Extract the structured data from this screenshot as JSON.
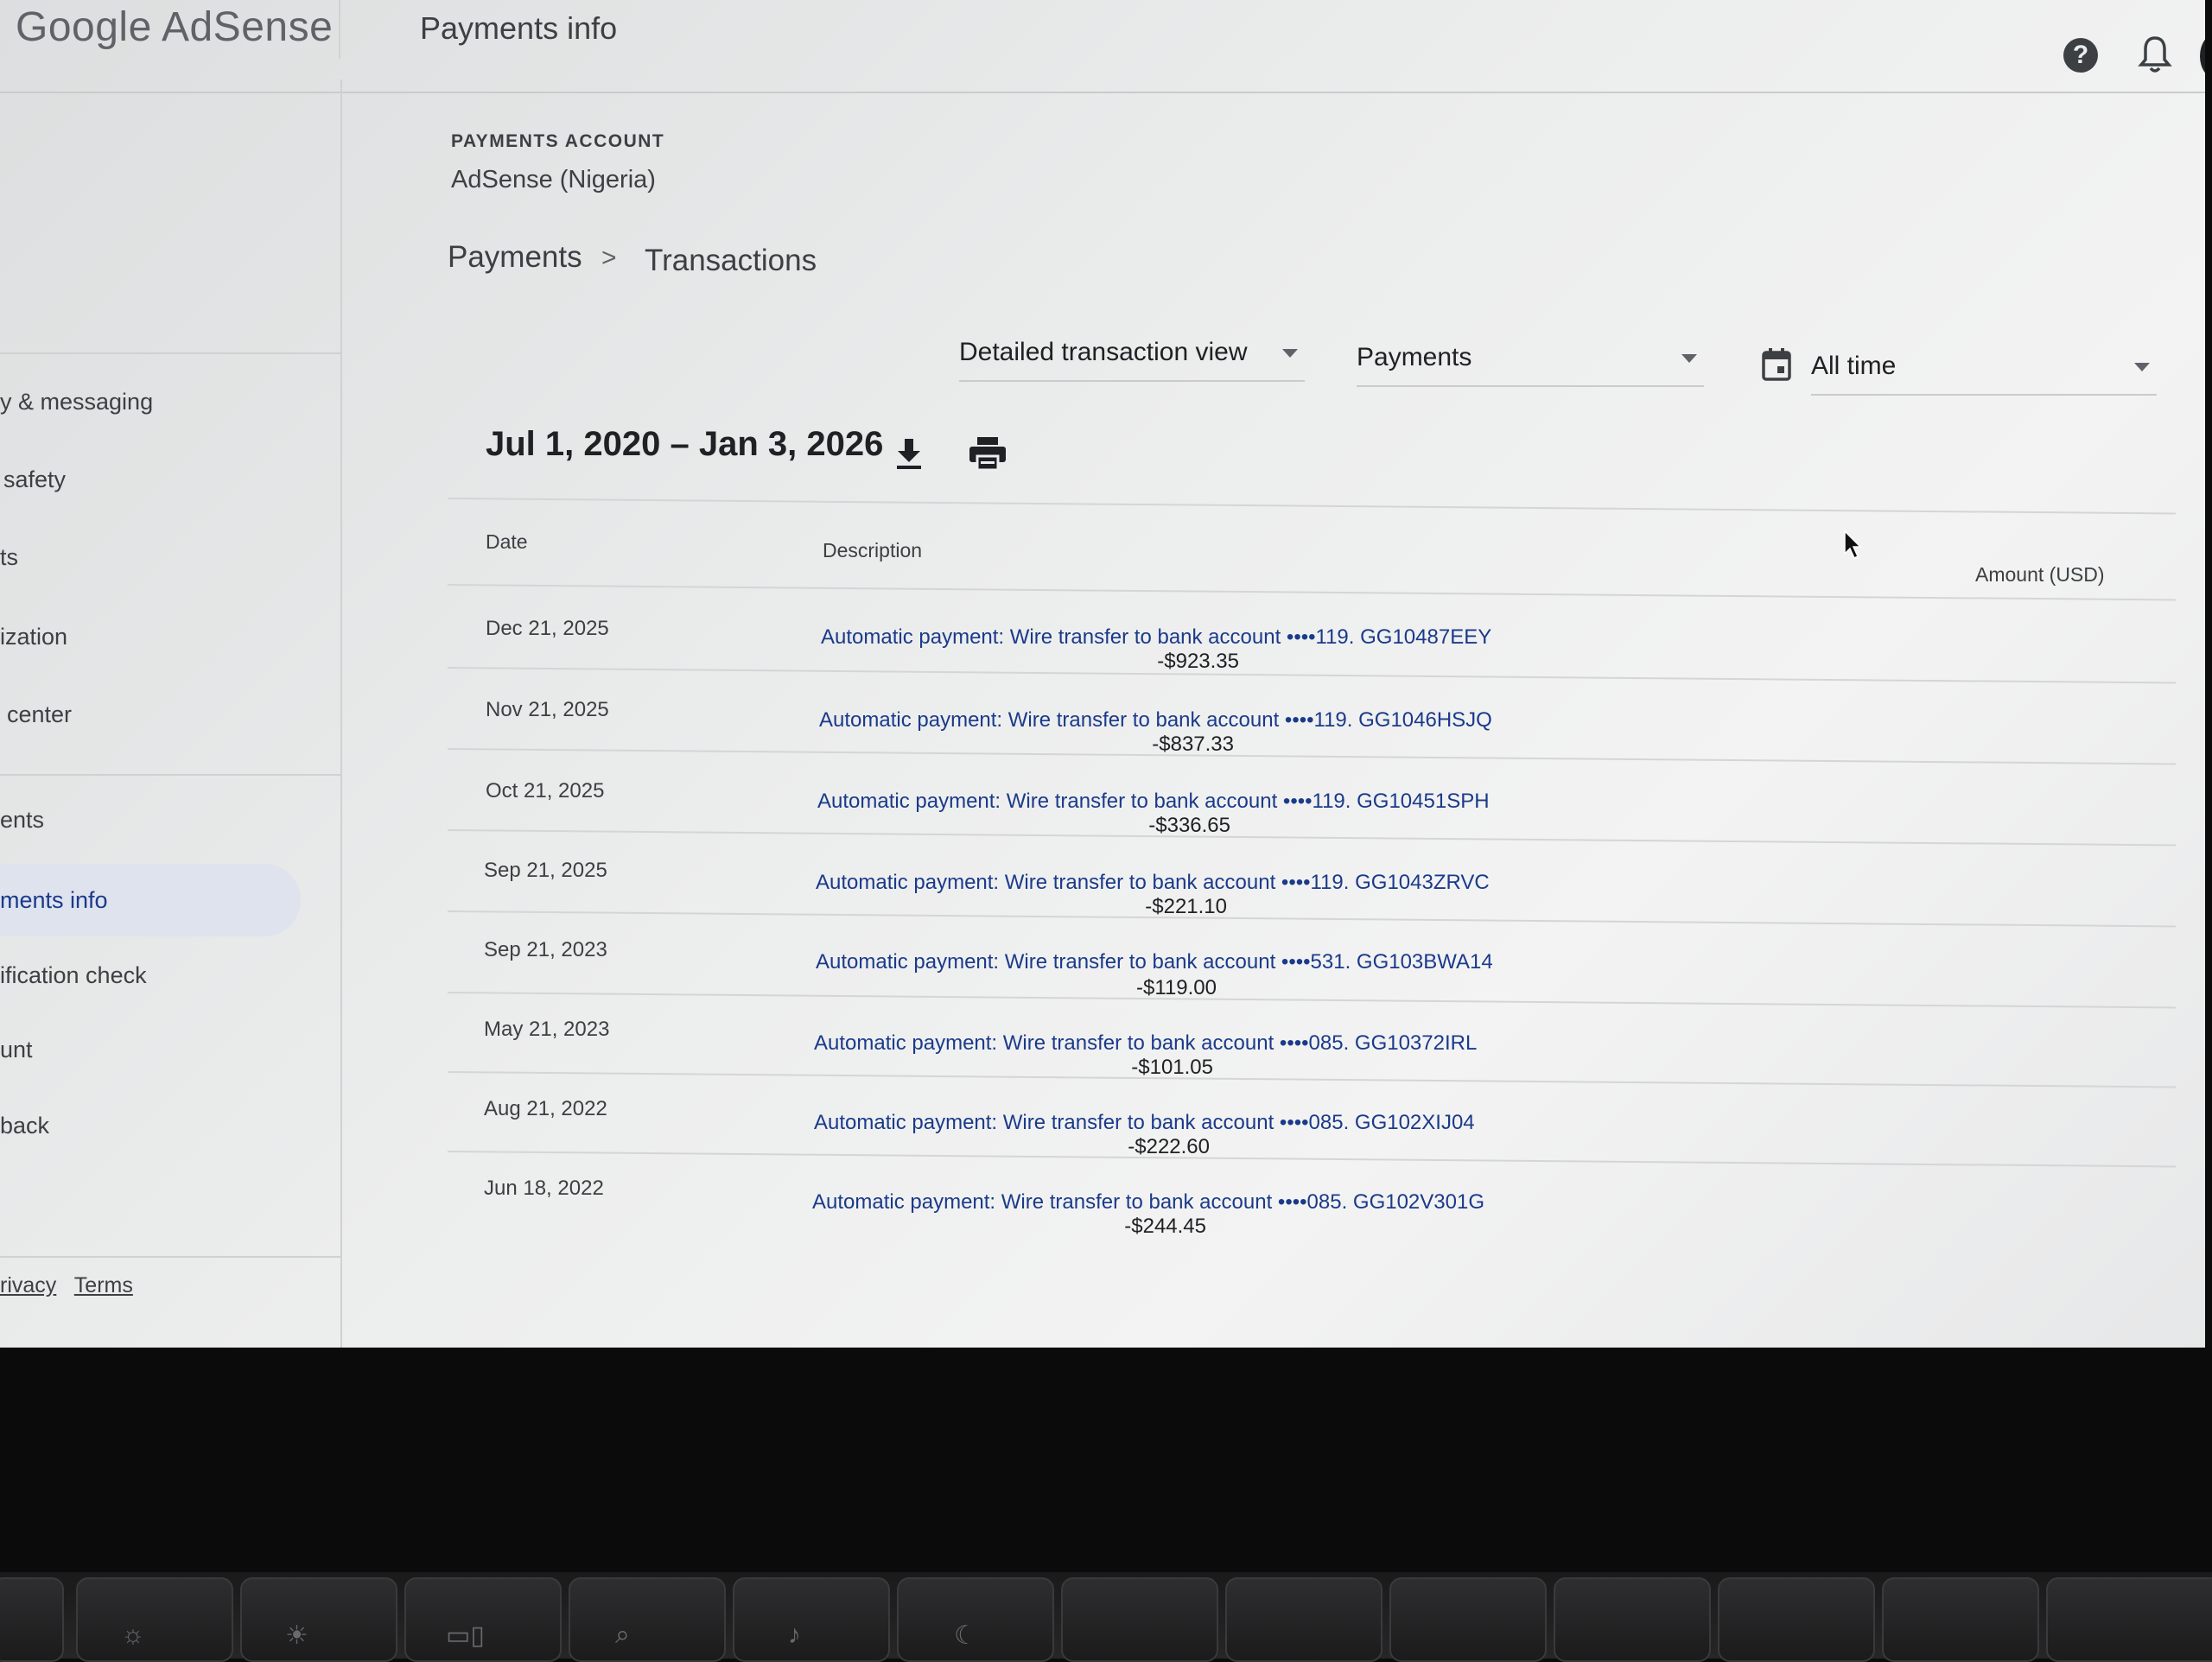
{
  "header": {
    "logo": "Google AdSense",
    "title": "Payments info",
    "help_icon": "?"
  },
  "sidebar": {
    "items": [
      {
        "label": "y & messaging"
      },
      {
        "label": "safety"
      },
      {
        "label": "ts"
      },
      {
        "label": "ization"
      },
      {
        "label": "center"
      },
      {
        "label": "ents"
      },
      {
        "label": "ments info",
        "active": true
      },
      {
        "label": "ification check"
      },
      {
        "label": "unt"
      },
      {
        "label": "back"
      }
    ],
    "footer": {
      "privacy": "rivacy",
      "terms": "Terms"
    }
  },
  "account": {
    "label": "PAYMENTS ACCOUNT",
    "name": "AdSense (Nigeria)"
  },
  "breadcrumb": {
    "parent": "Payments",
    "separator": ">",
    "current": "Transactions"
  },
  "filters": {
    "view": "Detailed transaction view",
    "type": "Payments",
    "period": "All time"
  },
  "range": "Jul 1, 2020 – Jan 3, 2026",
  "table": {
    "headers": {
      "date": "Date",
      "description": "Description",
      "amount": "Amount (USD)"
    },
    "rows": [
      {
        "date": "Dec 21, 2025",
        "description": "Automatic payment: Wire transfer to bank account ••••119. GG10487EEY",
        "amount": "-$923.35"
      },
      {
        "date": "Nov 21, 2025",
        "description": "Automatic payment: Wire transfer to bank account ••••119. GG1046HSJQ",
        "amount": "-$837.33"
      },
      {
        "date": "Oct 21, 2025",
        "description": "Automatic payment: Wire transfer to bank account ••••119. GG10451SPH",
        "amount": "-$336.65"
      },
      {
        "date": "Sep 21, 2025",
        "description": "Automatic payment: Wire transfer to bank account ••••119. GG1043ZRVC",
        "amount": "-$221.10"
      },
      {
        "date": "Sep 21, 2023",
        "description": "Automatic payment: Wire transfer to bank account ••••531. GG103BWA14",
        "amount": "-$119.00"
      },
      {
        "date": "May 21, 2023",
        "description": "Automatic payment: Wire transfer to bank account ••••085. GG10372IRL",
        "amount": "-$101.05"
      },
      {
        "date": "Aug 21, 2022",
        "description": "Automatic payment: Wire transfer to bank account ••••085. GG102XIJ04",
        "amount": "-$222.60"
      },
      {
        "date": "Jun 18, 2022",
        "description": "Automatic payment: Wire transfer to bank account ••••085. GG102V301G",
        "amount": "-$244.45"
      }
    ]
  },
  "colors": {
    "link": "#1a3a8a",
    "active_nav_bg": "#dfe3ee",
    "text": "#3c4043"
  }
}
